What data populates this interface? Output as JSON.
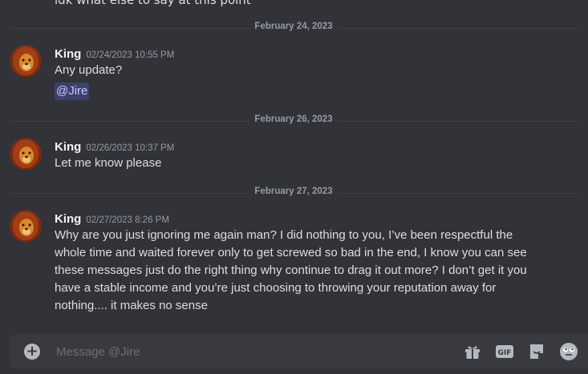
{
  "chat": {
    "previous_text": "idk what else to say at this point",
    "dividers": [
      "February 24, 2023",
      "February 26, 2023",
      "February 27, 2023"
    ],
    "messages": [
      {
        "author": "King",
        "timestamp": "02/24/2023 10:55 PM",
        "text": "Any update?",
        "mention": "@Jire"
      },
      {
        "author": "King",
        "timestamp": "02/26/2023 10:37 PM",
        "text": "Let me know please"
      },
      {
        "author": "King",
        "timestamp": "02/27/2023 8:26 PM",
        "lines": [
          "Why are you just ignoring me again man? I did nothing to you, I’ve been respectful the",
          "whole time and waited forever only to get screwed so bad in the end, I know you can see",
          "these messages just do the right thing why continue to drag it out more? I don’t get it you",
          "have a stable income and you’re just choosing to throwing your reputation away for",
          "nothing.... it makes no sense"
        ]
      }
    ]
  },
  "composer": {
    "placeholder": "Message @Jire",
    "icons": [
      "add-attachment-icon",
      "gift-icon",
      "gif-icon",
      "sticker-icon",
      "emoji-icon"
    ],
    "gif_label": "GIF"
  },
  "colors": {
    "background": "#313338",
    "composer": "#383a40",
    "mention_bg": "#3c4270",
    "divider_text": "#949ba4"
  }
}
